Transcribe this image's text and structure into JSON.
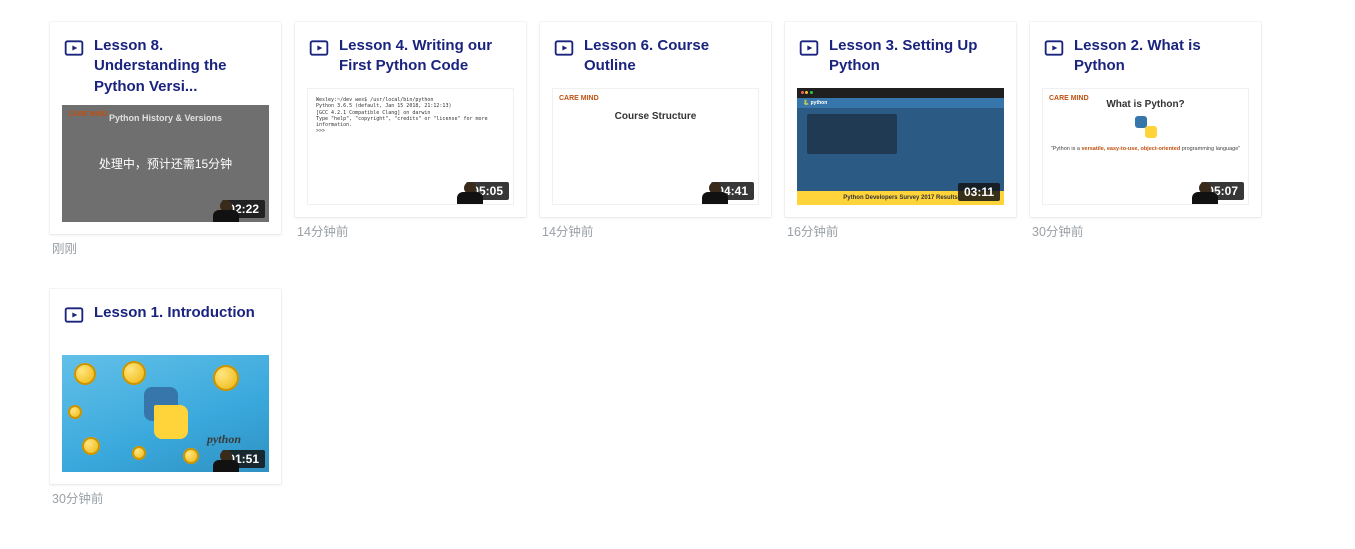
{
  "cards": [
    {
      "title": "Lesson 8. Understanding the Python Versi...",
      "duration": "02:22",
      "timestamp": "刚刚",
      "processing_text": "处理中，预计还需15分钟",
      "thumb_title": "Python History & Versions",
      "thumb_logo": "CARE MIND"
    },
    {
      "title": "Lesson 4. Writing our First Python Code",
      "duration": "05:05",
      "timestamp": "14分钟前",
      "terminal_text": "Wesley:~/dev wes$ /usr/local/bin/python\nPython 3.6.5 (default, Jan 15 2018, 21:12:13)\n[GCC 4.2.1 Compatible Clang] on darwin\nType \"help\", \"copyright\", \"credits\" or \"license\" for more information.\n>>>"
    },
    {
      "title": "Lesson 6. Course Outline",
      "duration": "04:41",
      "timestamp": "14分钟前",
      "thumb_center": "Course Structure",
      "thumb_logo": "CARE MIND"
    },
    {
      "title": "Lesson 3. Setting Up Python",
      "duration": "03:11",
      "timestamp": "16分钟前",
      "py_brand": "🐍 python",
      "py_banner": "Python Developers Survey 2017 Results"
    },
    {
      "title": "Lesson 2. What is Python",
      "duration": "05:07",
      "timestamp": "30分钟前",
      "thumb_q": "What is Python?",
      "thumb_logo": "CARE MIND",
      "thumb_desc_pre": "\"Python is a ",
      "thumb_desc_hl": "versatile, easy-to-use, object-oriented",
      "thumb_desc_post": " programming language\""
    },
    {
      "title": "Lesson 1. Introduction",
      "duration": "01:51",
      "timestamp": "30分钟前",
      "logo_text": "python"
    }
  ]
}
